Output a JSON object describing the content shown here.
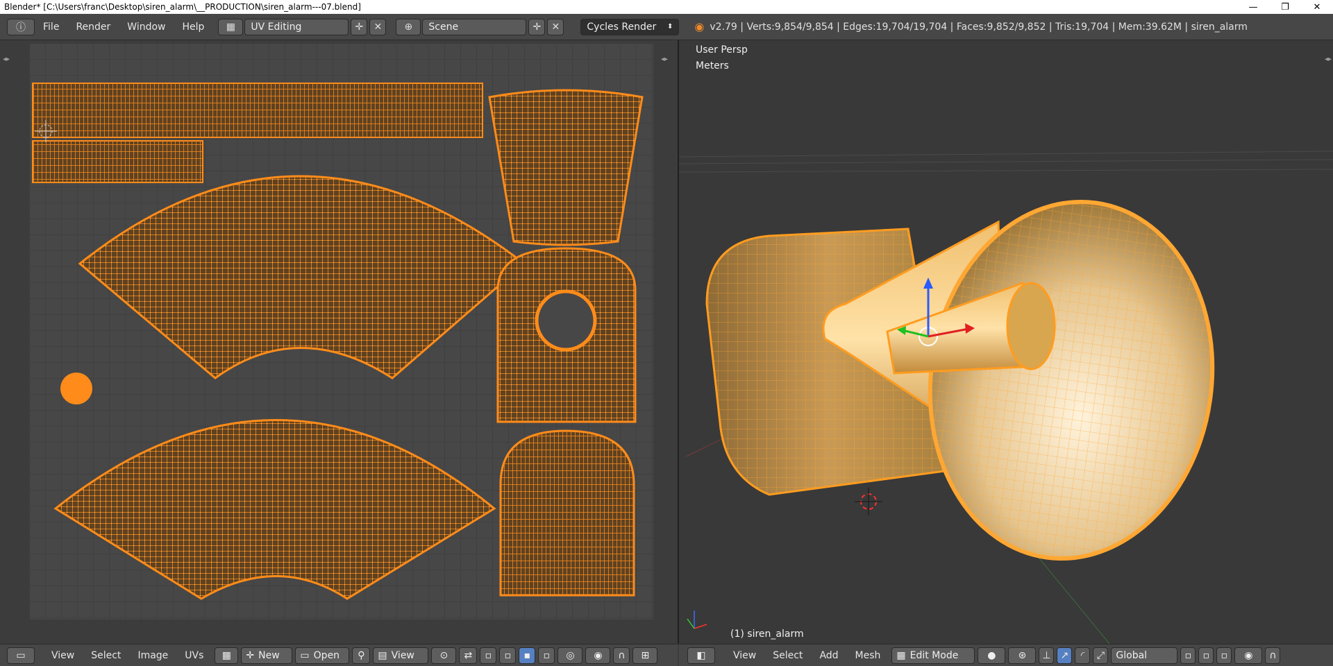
{
  "window": {
    "title": "Blender* [C:\\Users\\franc\\Desktop\\siren_alarm\\__PRODUCTION\\siren_alarm---07.blend]",
    "minimize": "—",
    "restore": "❐",
    "close": "✕"
  },
  "topbar": {
    "menus": [
      "File",
      "Render",
      "Window",
      "Help"
    ],
    "layout": "UV Editing",
    "scene": "Scene",
    "engine": "Cycles Render",
    "stats": "v2.79 | Verts:9,854/9,854 | Edges:19,704/19,704 | Faces:9,852/9,852 | Tris:19,704 | Mem:39.62M | siren_alarm"
  },
  "viewport": {
    "perspective": "User Persp",
    "units": "Meters",
    "object_label": "(1) siren_alarm"
  },
  "uv_bottom": {
    "menus": [
      "View",
      "Select",
      "Image",
      "UVs"
    ],
    "new_label": "New",
    "open_label": "Open",
    "view_label": "View"
  },
  "view3d_bottom": {
    "menus": [
      "View",
      "Select",
      "Add",
      "Mesh"
    ],
    "mode": "Edit Mode",
    "orientation": "Global"
  },
  "colors": {
    "accent": "#ff8c1a",
    "wire": "#ffa733",
    "bg": "#3d3d3d"
  },
  "icons": {
    "info": "info-icon",
    "blender": "blender-logo-icon",
    "cursor": "3d-cursor-icon"
  }
}
